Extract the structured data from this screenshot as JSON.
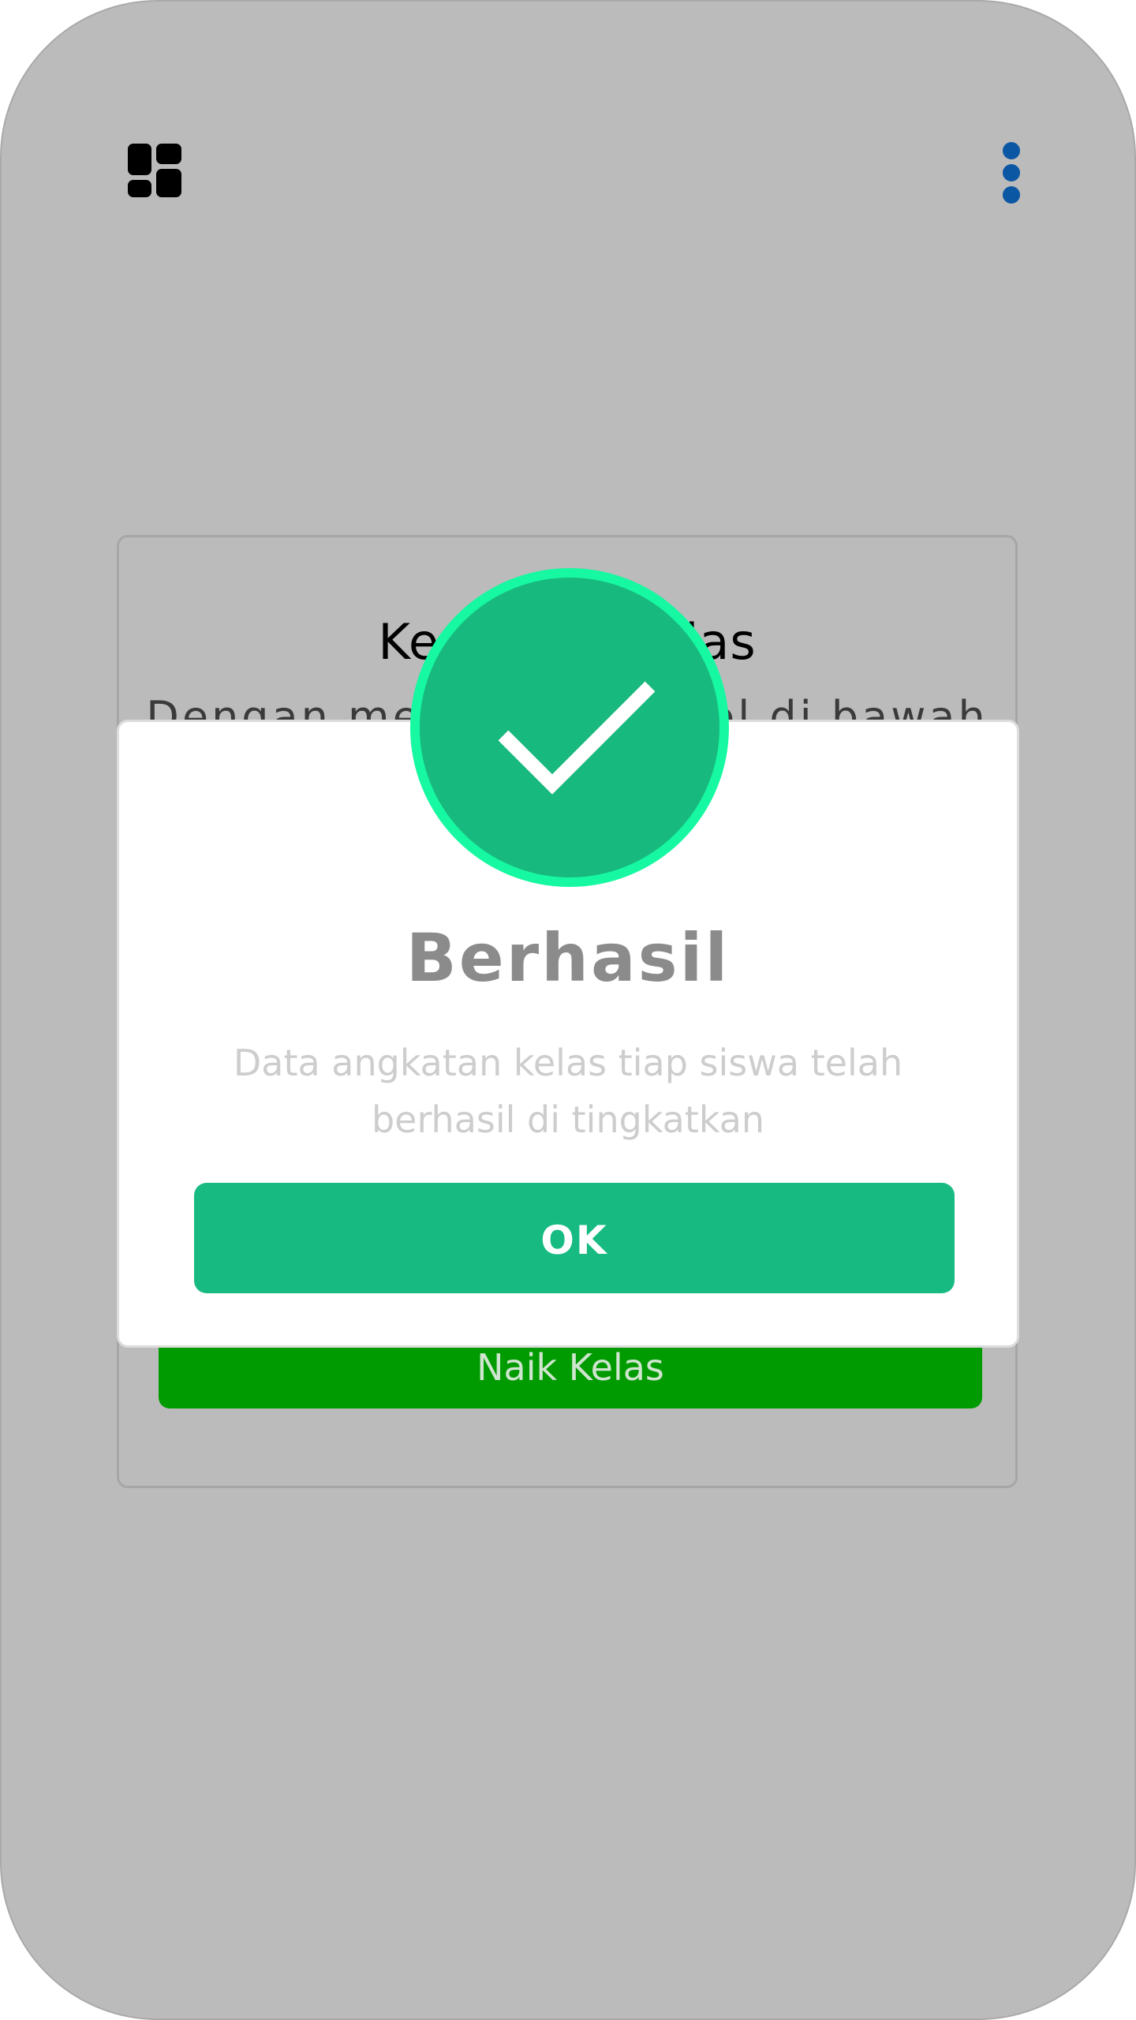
{
  "header": {
    "menu_icon": "grid-icon",
    "more_icon": "more-vertical-icon"
  },
  "card": {
    "title": "Kenaikan Kelas",
    "description": "Dengan menekan tombol di bawah",
    "button_label": "Naik Kelas"
  },
  "dialog": {
    "icon": "checkmark-icon",
    "title": "Berhasil",
    "message": "Data angkatan kelas tiap siswa telah berhasil di tingkatkan",
    "ok_label": "OK"
  },
  "colors": {
    "background_overlay": "#bbbbbb",
    "success": "#18b97e",
    "success_ring": "#16f8a1",
    "ok_button": "#17bb82",
    "naik_button": "#009b00",
    "more_icon": "#0b57a4"
  }
}
